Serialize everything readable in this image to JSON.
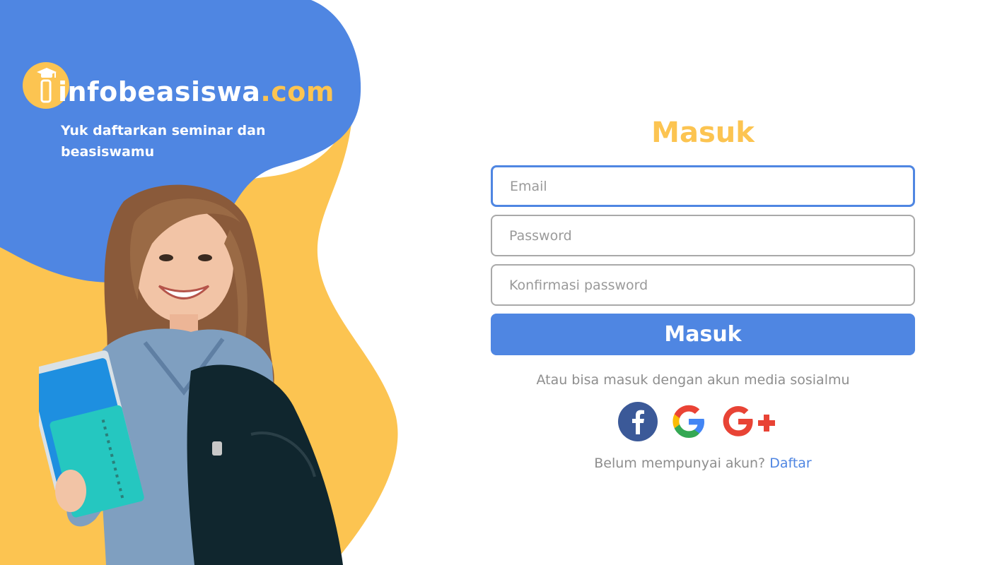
{
  "brand": {
    "name": "infobeasiswa",
    "tld": ".com",
    "tagline": "Yuk daftarkan seminar dan beasiswamu"
  },
  "colors": {
    "primary_blue": "#4f86e2",
    "accent_yellow": "#fcc451",
    "text_gray": "#8e8e8e",
    "border_gray": "#a9a9a9"
  },
  "form": {
    "title": "Masuk",
    "email_placeholder": "Email",
    "password_placeholder": "Password",
    "confirm_placeholder": "Konfirmasi password",
    "submit_label": "Masuk",
    "social_hint": "Atau bisa masuk dengan akun media sosialmu",
    "social": [
      {
        "icon": "facebook-icon",
        "label": "f"
      },
      {
        "icon": "google-icon",
        "label": "G"
      },
      {
        "icon": "google-plus-icon",
        "label": "G+"
      }
    ],
    "signup_prompt": "Belum mempunyai akun?",
    "signup_link": "Daftar"
  },
  "illustration": {
    "icon": "student-with-books-illustration"
  }
}
